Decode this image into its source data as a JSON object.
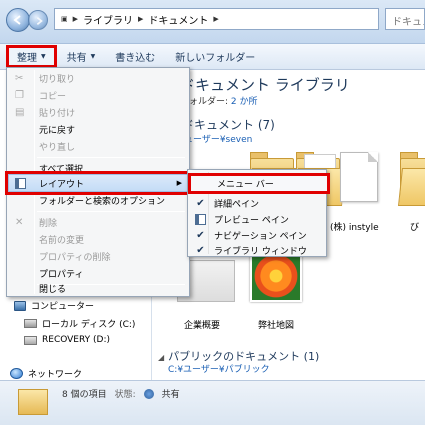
{
  "address": {
    "crumbs": [
      "ライブラリ",
      "ドキュメント"
    ],
    "search_placeholder": "ドキュメン"
  },
  "toolbar": {
    "organize": "整理",
    "share": "共有",
    "burn": "書き込む",
    "new_folder": "新しいフォルダー"
  },
  "library": {
    "title": "ドキュメント ライブラリ",
    "includes_label": "フォルダー:",
    "includes_link": "2 か所",
    "section1": "ドキュメント (7)",
    "section1_path": "ューザー¥seven",
    "section2": "パブリックのドキュメント (1)",
    "section2_path": "C:¥ユーザー¥パブリック"
  },
  "files": {
    "item_corp": "(株) instyle",
    "item_outline": "企業概要",
    "item_map": "弊社地図",
    "item_partial": "び"
  },
  "nav": {
    "computer": "コンピューター",
    "local_disk": "ローカル ディスク (C:)",
    "recovery": "RECOVERY (D:)",
    "network": "ネットワーク"
  },
  "status": {
    "count": "8 個の項目",
    "state_label": "状態:",
    "state_value": "共有"
  },
  "menu": {
    "cut": "切り取り",
    "copy": "コピー",
    "paste": "貼り付け",
    "undo": "元に戻す",
    "redo": "やり直し",
    "select_all": "すべて選択",
    "layout": "レイアウト",
    "folder_options": "フォルダーと検索のオプション",
    "delete": "削除",
    "rename": "名前の変更",
    "remove_props": "プロパティの削除",
    "properties": "プロパティ",
    "close": "閉じる"
  },
  "submenu": {
    "menu_bar": "メニュー バー",
    "details_pane": "詳細ペイン",
    "preview_pane": "プレビュー ペイン",
    "navigation_pane": "ナビゲーション ペイン",
    "library_pane": "ライブラリ ウィンドウ"
  },
  "colors": {
    "highlight_red": "#e00000",
    "menu_bg": "#f5f6f7",
    "link_blue": "#1a5fb4"
  }
}
